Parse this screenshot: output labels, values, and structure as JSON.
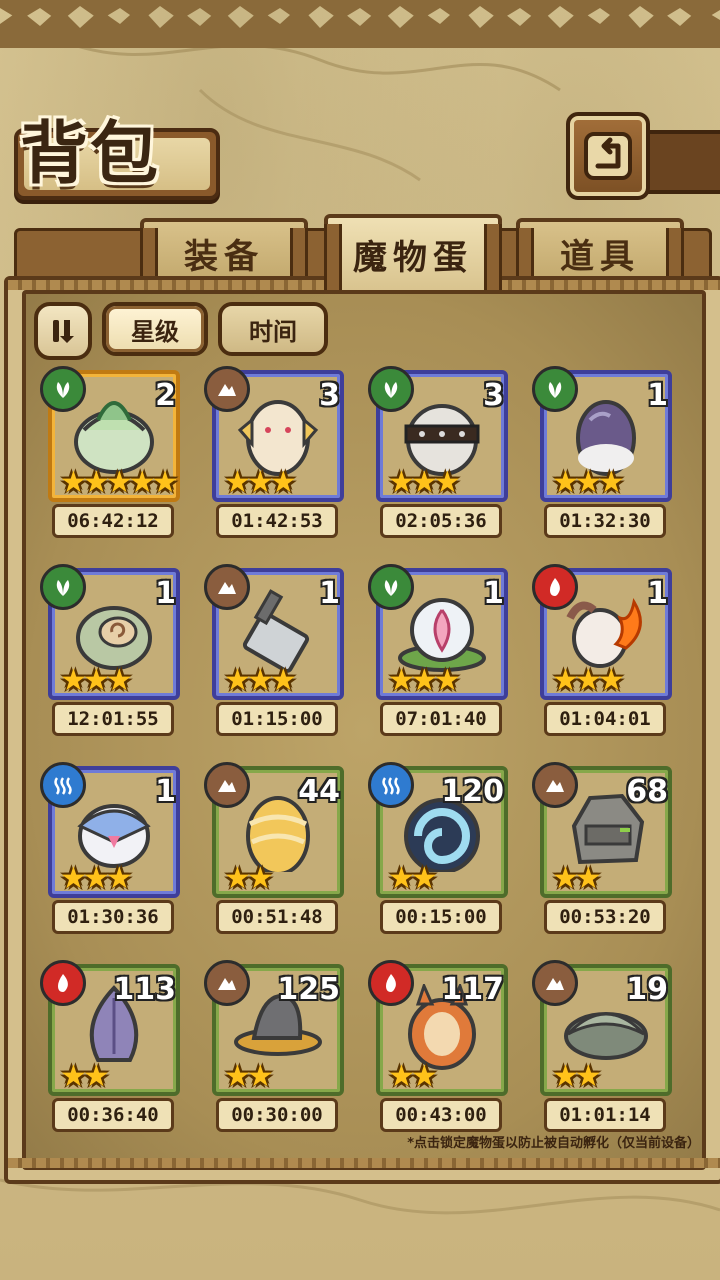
{
  "header": {
    "title": "背包",
    "back_icon": "return-arrow-icon"
  },
  "tabs": [
    {
      "label": "装备",
      "active": false
    },
    {
      "label": "魔物蛋",
      "active": true
    },
    {
      "label": "道具",
      "active": false
    }
  ],
  "filters": {
    "sort_icon": "pause-sort-icon",
    "star_label": "星级",
    "time_label": "时间"
  },
  "eggs": [
    {
      "element": "grass",
      "count": "2",
      "stars": 5,
      "timer": "06:42:12",
      "frame": "gold",
      "art": "cabbage"
    },
    {
      "element": "earth",
      "count": "3",
      "stars": 3,
      "timer": "01:42:53",
      "frame": "blue",
      "art": "fluffy"
    },
    {
      "element": "grass",
      "count": "3",
      "stars": 3,
      "timer": "02:05:36",
      "frame": "blue",
      "art": "helmet"
    },
    {
      "element": "grass",
      "count": "1",
      "stars": 3,
      "timer": "01:32:30",
      "frame": "blue",
      "art": "purple"
    },
    {
      "element": "grass",
      "count": "1",
      "stars": 3,
      "timer": "12:01:55",
      "frame": "blue",
      "art": "pod"
    },
    {
      "element": "earth",
      "count": "1",
      "stars": 3,
      "timer": "01:15:00",
      "frame": "blue",
      "art": "cleaver"
    },
    {
      "element": "grass",
      "count": "1",
      "stars": 3,
      "timer": "07:01:40",
      "frame": "blue",
      "art": "lotus"
    },
    {
      "element": "fire",
      "count": "1",
      "stars": 3,
      "timer": "01:04:01",
      "frame": "blue",
      "art": "flame"
    },
    {
      "element": "water",
      "count": "1",
      "stars": 3,
      "timer": "01:30:36",
      "frame": "blue",
      "art": "sailor"
    },
    {
      "element": "earth",
      "count": "44",
      "stars": 2,
      "timer": "00:51:48",
      "frame": "green",
      "art": "golden"
    },
    {
      "element": "water",
      "count": "120",
      "stars": 2,
      "timer": "00:15:00",
      "frame": "green",
      "art": "shell"
    },
    {
      "element": "earth",
      "count": "68",
      "stars": 2,
      "timer": "00:53:20",
      "frame": "green",
      "art": "rock"
    },
    {
      "element": "fire",
      "count": "113",
      "stars": 2,
      "timer": "00:36:40",
      "frame": "green",
      "art": "bulb"
    },
    {
      "element": "earth",
      "count": "125",
      "stars": 2,
      "timer": "00:30:00",
      "frame": "green",
      "art": "hat"
    },
    {
      "element": "fire",
      "count": "117",
      "stars": 2,
      "timer": "00:43:00",
      "frame": "green",
      "art": "fox"
    },
    {
      "element": "earth",
      "count": "19",
      "stars": 2,
      "timer": "01:01:14",
      "frame": "green",
      "art": "leafy"
    }
  ],
  "footer": {
    "tip": "*点击锁定魔物蛋以防止被自动孵化（仅当前设备）"
  },
  "colors": {
    "grass": "#3b8a3a",
    "earth": "#8a5d3e",
    "fire": "#d12a26",
    "water": "#2f7bd0",
    "star": "#ffc21a"
  }
}
